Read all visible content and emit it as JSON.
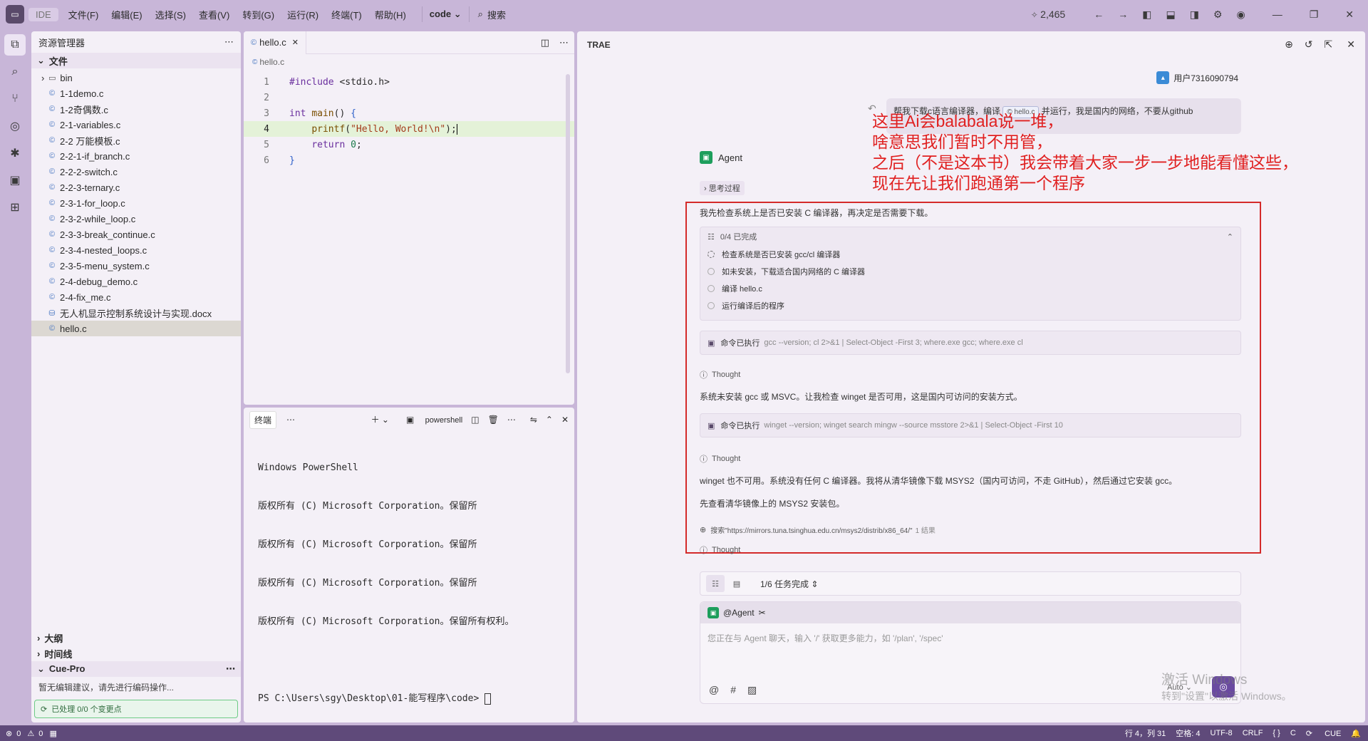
{
  "titlebar": {
    "ide_label": "IDE",
    "menu": [
      "文件(F)",
      "编辑(E)",
      "选择(S)",
      "查看(V)",
      "转到(G)",
      "运行(R)",
      "终端(T)",
      "帮助(H)"
    ],
    "project": "code",
    "search": "搜索",
    "count": "2,465"
  },
  "explorer": {
    "title": "资源管理器",
    "section": "文件",
    "files": [
      {
        "name": "bin",
        "type": "folder"
      },
      {
        "name": "1-1demo.c",
        "type": "c"
      },
      {
        "name": "1-2奇偶数.c",
        "type": "c"
      },
      {
        "name": "2-1-variables.c",
        "type": "c"
      },
      {
        "name": "2-2 万能模板.c",
        "type": "c"
      },
      {
        "name": "2-2-1-if_branch.c",
        "type": "c"
      },
      {
        "name": "2-2-2-switch.c",
        "type": "c"
      },
      {
        "name": "2-2-3-ternary.c",
        "type": "c"
      },
      {
        "name": "2-3-1-for_loop.c",
        "type": "c"
      },
      {
        "name": "2-3-2-while_loop.c",
        "type": "c"
      },
      {
        "name": "2-3-3-break_continue.c",
        "type": "c"
      },
      {
        "name": "2-3-4-nested_loops.c",
        "type": "c"
      },
      {
        "name": "2-3-5-menu_system.c",
        "type": "c"
      },
      {
        "name": "2-4-debug_demo.c",
        "type": "c"
      },
      {
        "name": "2-4-fix_me.c",
        "type": "c"
      },
      {
        "name": "无人机显示控制系统设计与实现.docx",
        "type": "docx"
      },
      {
        "name": "hello.c",
        "type": "c",
        "active": true
      }
    ],
    "outline": "大纲",
    "timeline": "时间线",
    "cue_title": "Cue-Pro",
    "cue_message": "暂无编辑建议，请先进行编码操作...",
    "cue_status": "已处理 0/0 个变更点"
  },
  "editor": {
    "tab": "hello.c",
    "breadcrumb": "hello.c",
    "lines": [
      {
        "n": "1",
        "html": "<span class=\"kw\">#include</span> &lt;stdio.h&gt;"
      },
      {
        "n": "2",
        "html": ""
      },
      {
        "n": "3",
        "html": "<span class=\"kw\">int</span> <span class=\"fn\">main</span>() <span class=\"br\">{</span>"
      },
      {
        "n": "4",
        "html": "    <span class=\"fn\">printf</span>(<span class=\"str\">\"Hello, World!\\n\"</span>);",
        "current": true
      },
      {
        "n": "5",
        "html": "    <span class=\"kw\">return</span> <span class=\"num\">0</span>;"
      },
      {
        "n": "6",
        "html": "<span class=\"br\">}</span>"
      }
    ]
  },
  "terminal": {
    "tab_label": "终端",
    "shell": "powershell",
    "output": [
      "Windows PowerShell",
      "版权所有 (C) Microsoft Corporation。保留所",
      "版权所有 (C) Microsoft Corporation。保留所",
      "版权所有 (C) Microsoft Corporation。保留所",
      "版权所有 (C) Microsoft Corporation。保留所有权利。",
      "",
      "PS C:\\Users\\sgy\\Desktop\\01-能写程序\\code> "
    ]
  },
  "ai_panel": {
    "title": "TRAE",
    "user_name": "用户7316090794",
    "user_message_prefix": "帮我下载c语言编译器，编译",
    "user_message_chip": "hello.c",
    "user_message_suffix": "并运行，我是国内的网络，不要从github",
    "agent_name": "Agent",
    "thinking_label": "思考过程",
    "intro": "我先检查系统上是否已安装 C 编译器，再决定是否需要下载。",
    "todo_header": "0/4 已完成",
    "todos": [
      "检查系统是否已安装 gcc/cl 编译器",
      "如未安装，下载适合国内网络的 C 编译器",
      "编译 hello.c",
      "运行编译后的程序"
    ],
    "cmd1_label": "命令已执行",
    "cmd1_text": "gcc --version; cl 2>&1 | Select-Object -First 3; where.exe gcc; where.exe cl",
    "thought_label": "Thought",
    "msg2": "系统未安装 gcc 或 MSVC。让我检查 winget 是否可用，这是国内可访问的安装方式。",
    "cmd2_label": "命令已执行",
    "cmd2_text": "winget --version; winget search mingw --source msstore 2>&1 | Select-Object -First 10",
    "msg3": "winget 也不可用。系统没有任何 C 编译器。我将从清华镜像下载 MSYS2（国内可访问，不走 GitHub），然后通过它安装 gcc。",
    "msg4": "先查看清华镜像上的 MSYS2 安装包。",
    "search_text": "搜索\"https://mirrors.tuna.tsinghua.edu.cn/msys2/distrib/x86_64/\"",
    "search_count": "1 结果",
    "annotation": [
      "这里Ai会balabala说一堆，",
      "啥意思我们暂时不用管，",
      "之后（不是这本书）我会带着大家一步一步地能看懂这些，",
      "现在先让我们跑通第一个程序"
    ],
    "task_status": "1/6 任务完成",
    "input_mention": "@Agent",
    "input_placeholder": "您正在与 Agent 聊天，输入 '/' 获取更多能力，如 '/plan', '/spec'",
    "auto_label": "Auto",
    "watermark_title": "激活 Windows",
    "watermark_sub": "转到\"设置\"以激活 Windows。"
  },
  "statusbar": {
    "left": [
      "0",
      "0"
    ],
    "position": "行 4，列 31",
    "spaces": "空格: 4",
    "encoding": "UTF-8",
    "eol": "CRLF",
    "lang": "C",
    "cue": "CUE"
  }
}
